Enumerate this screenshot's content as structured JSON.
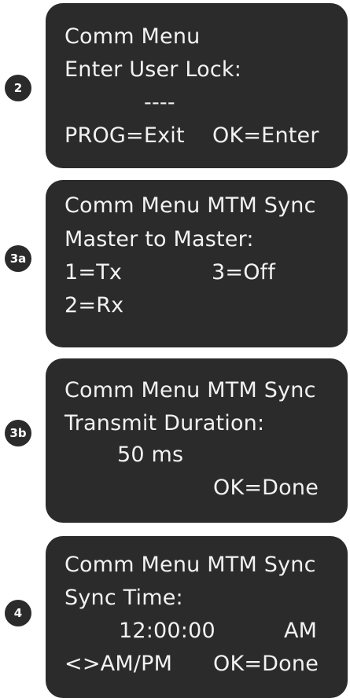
{
  "screens": [
    {
      "step": "2",
      "lines": [
        "Comm Menu",
        "Enter User Lock:",
        "----",
        "PROG=Exit",
        "OK=Enter"
      ]
    },
    {
      "step": "3a",
      "lines": [
        "Comm Menu MTM Sync",
        "Master to Master:",
        "1=Tx",
        "3=Off",
        "2=Rx"
      ]
    },
    {
      "step": "3b",
      "lines": [
        "Comm Menu MTM Sync",
        "Transmit Duration:",
        "50 ms",
        "OK=Done"
      ]
    },
    {
      "step": "4",
      "lines": [
        "Comm Menu MTM Sync",
        "Sync Time:",
        "12:00:00",
        "AM",
        "<>AM/PM",
        "OK=Done"
      ]
    }
  ]
}
